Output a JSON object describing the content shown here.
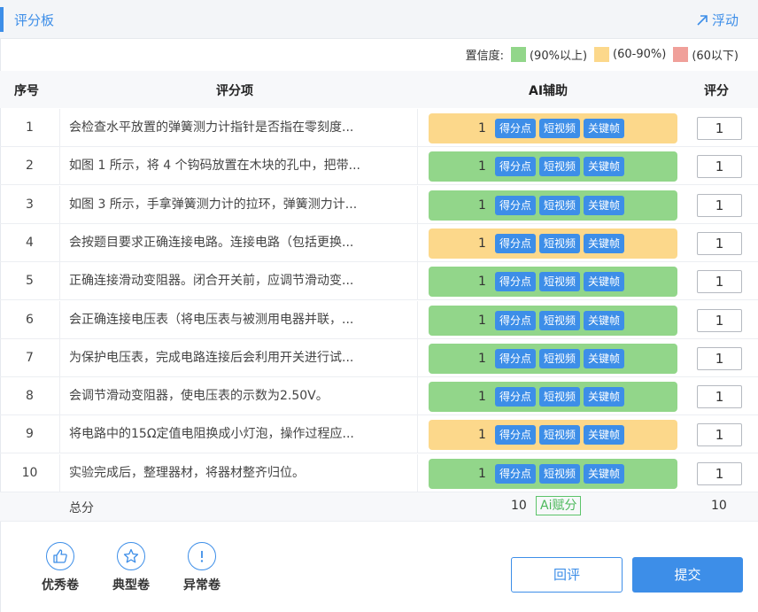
{
  "header": {
    "title": "评分板",
    "float_label": "浮动"
  },
  "legend": {
    "label": "置信度:",
    "items": [
      {
        "text": "(90%以上)",
        "color": "#92d68a"
      },
      {
        "text": "(60-90%)",
        "color": "#fcd88b"
      },
      {
        "text": "(60以下)",
        "color": "#f0a09a"
      }
    ]
  },
  "table": {
    "headers": {
      "index": "序号",
      "item": "评分项",
      "ai": "AI辅助",
      "score": "评分"
    },
    "tags": {
      "points": "得分点",
      "video": "短视频",
      "keyframe": "关键帧"
    },
    "rows": [
      {
        "index": "1",
        "item": "会检查水平放置的弹簧测力计指针是否指在零刻度...",
        "ai_value": "1",
        "level": "mid",
        "score": "1"
      },
      {
        "index": "2",
        "item": "如图 1 所示，将 4 个钩码放置在木块的孔中，把带...",
        "ai_value": "1",
        "level": "high",
        "score": "1"
      },
      {
        "index": "3",
        "item": "如图 3 所示，手拿弹簧测力计的拉环，弹簧测力计...",
        "ai_value": "1",
        "level": "high",
        "score": "1"
      },
      {
        "index": "4",
        "item": "会按题目要求正确连接电路。连接电路（包括更换...",
        "ai_value": "1",
        "level": "mid",
        "score": "1"
      },
      {
        "index": "5",
        "item": "正确连接滑动变阻器。闭合开关前，应调节滑动变...",
        "ai_value": "1",
        "level": "high",
        "score": "1"
      },
      {
        "index": "6",
        "item": "会正确连接电压表（将电压表与被测用电器并联，...",
        "ai_value": "1",
        "level": "high",
        "score": "1"
      },
      {
        "index": "7",
        "item": "为保护电压表，完成电路连接后会利用开关进行试...",
        "ai_value": "1",
        "level": "high",
        "score": "1"
      },
      {
        "index": "8",
        "item": "会调节滑动变阻器，使电压表的示数为2.50V。",
        "ai_value": "1",
        "level": "high",
        "score": "1"
      },
      {
        "index": "9",
        "item": "将电路中的15Ω定值电阻换成小灯泡，操作过程应...",
        "ai_value": "1",
        "level": "mid",
        "score": "1"
      },
      {
        "index": "10",
        "item": "实验完成后，整理器材，将器材整齐归位。",
        "ai_value": "1",
        "level": "high",
        "score": "1"
      }
    ]
  },
  "total": {
    "label": "总分",
    "ai_value": "10",
    "ai_button": "Ai赋分",
    "score": "10"
  },
  "tools": [
    {
      "label": "优秀卷",
      "icon": "thumbs-up-icon"
    },
    {
      "label": "典型卷",
      "icon": "star-icon"
    },
    {
      "label": "异常卷",
      "icon": "exclamation-icon"
    }
  ],
  "buttons": {
    "review": "回评",
    "submit": "提交"
  },
  "colors": {
    "accent": "#3d8ee8",
    "high": "#92d68a",
    "mid": "#fcd88b",
    "low": "#f0a09a"
  }
}
